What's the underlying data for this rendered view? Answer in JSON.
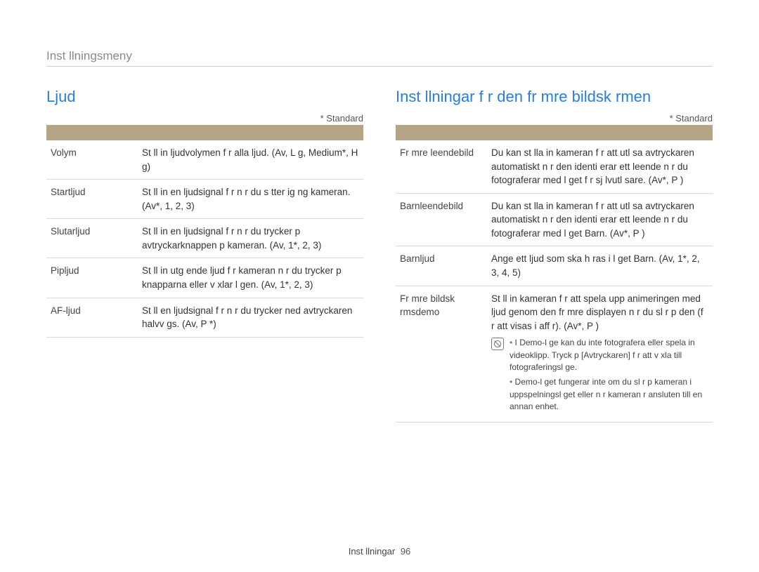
{
  "breadcrumb": "Inst llningsmeny",
  "standard_label": "* Standard",
  "footer": {
    "label": "Inst llningar",
    "page": "96"
  },
  "left": {
    "title": "Ljud",
    "rows": [
      {
        "name": "Volym",
        "desc": "St ll in ljudvolymen f r alla ljud. (Av, L g, Medium*, H g)"
      },
      {
        "name": "Startljud",
        "desc": "St ll in en ljudsignal f r n r du s tter ig ng kameran. (Av*, 1, 2, 3)"
      },
      {
        "name": "Slutarljud",
        "desc": "St ll in en ljudsignal f r n r du trycker p avtryckarknappen p  kameran. (Av, 1*, 2, 3)"
      },
      {
        "name": "Pipljud",
        "desc": "St ll in utg ende ljud f r kameran n r du trycker p  knapparna eller v xlar l gen. (Av, 1*, 2, 3)"
      },
      {
        "name": "AF-ljud",
        "desc": "St ll en ljudsignal f r n r du trycker ned avtryckaren halvv gs. (Av, P *)"
      }
    ]
  },
  "right": {
    "title": "Inst llningar f r den fr mre bildsk rmen",
    "rows": [
      {
        "name": "Fr mre leendebild",
        "desc": "Du kan st lla in kameran f r att utl sa avtryckaren automatiskt n r den identi erar ett leende n r du fotograferar med l get f r sj lvutl sare. (Av*, P )"
      },
      {
        "name": "Barnleendebild",
        "desc": "Du kan st lla in kameran f r att utl sa avtryckaren automatiskt n r den identi erar ett leende n r du fotograferar med l get Barn. (Av*, P )"
      },
      {
        "name": "Barnljud",
        "desc": "Ange ett ljud som ska h ras i l get Barn. (Av, 1*, 2, 3, 4, 5)"
      }
    ],
    "demo": {
      "name": "Fr mre bildsk rmsdemo",
      "intro": "St ll in kameran f r att spela upp animeringen med ljud genom den fr mre displayen n r du sl r p  den (f r att visas i aff r). (Av*, P )",
      "notes": [
        "I Demo-l ge kan du inte fotografera eller spela in videoklipp. Tryck p  [Avtryckaren] f r att v xla till fotograferingsl ge.",
        "Demo-l get fungerar inte om du sl r p  kameran i uppspelningsl get eller n r kameran  r ansluten till en annan enhet."
      ]
    }
  }
}
